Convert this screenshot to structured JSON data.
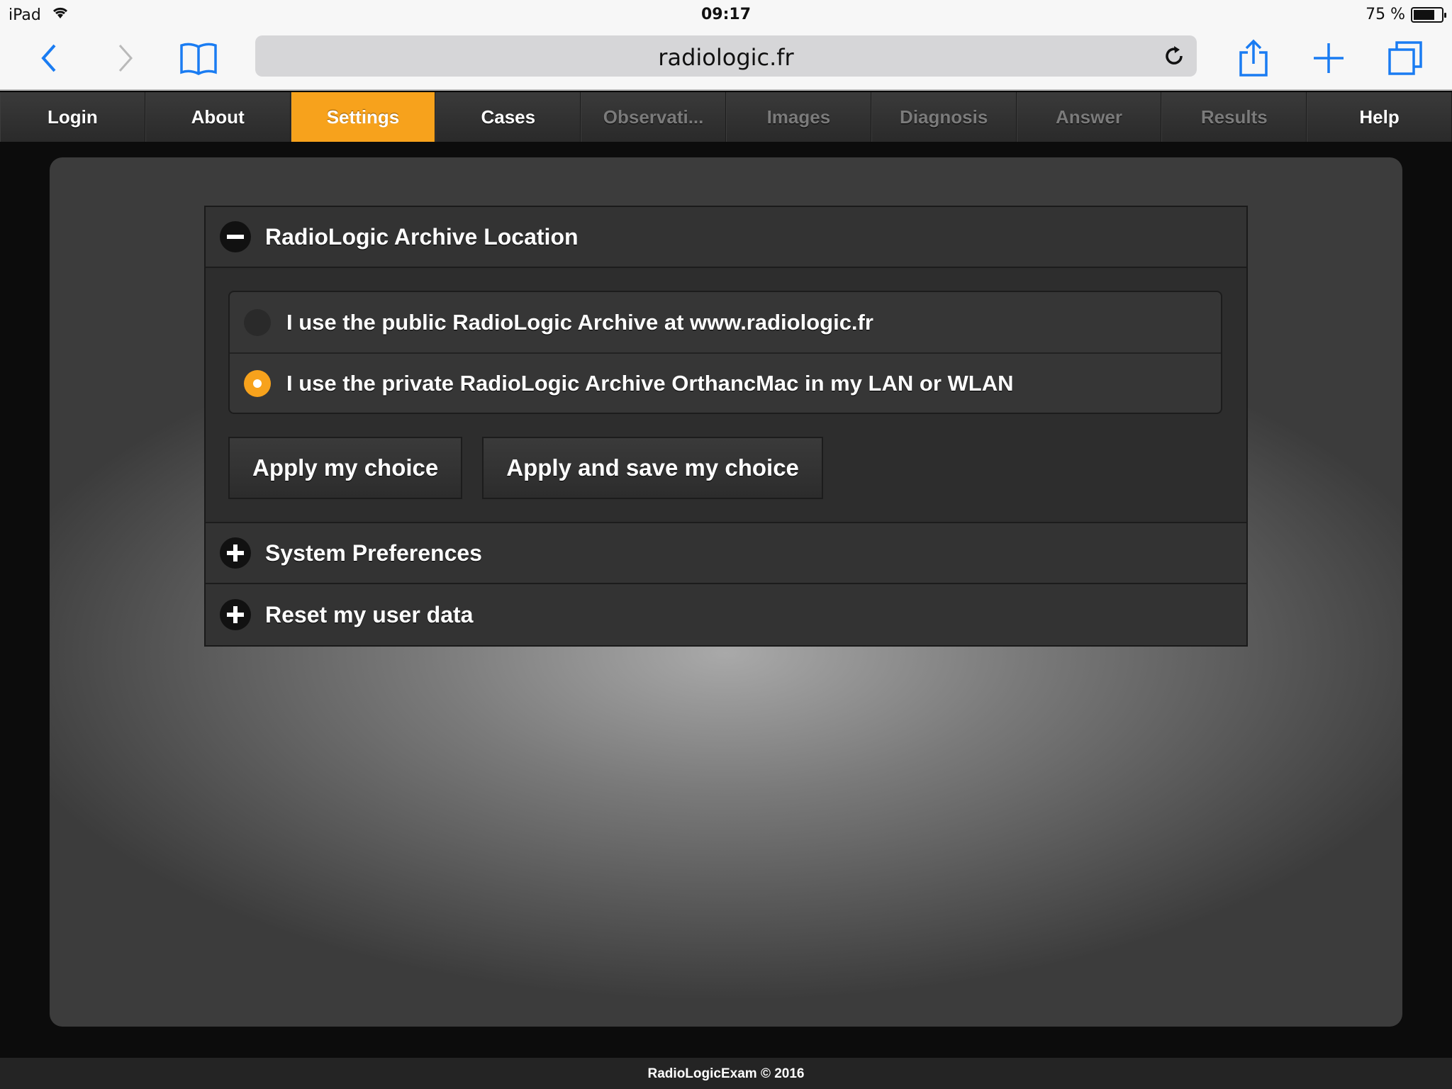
{
  "statusbar": {
    "device": "iPad",
    "time": "09:17",
    "battery_text": "75 %",
    "battery_level": 0.75
  },
  "browser": {
    "url": "radiologic.fr"
  },
  "nav": {
    "items": [
      {
        "label": "Login",
        "state": "normal"
      },
      {
        "label": "About",
        "state": "normal"
      },
      {
        "label": "Settings",
        "state": "active"
      },
      {
        "label": "Cases",
        "state": "normal"
      },
      {
        "label": "Observati...",
        "state": "disabled"
      },
      {
        "label": "Images",
        "state": "disabled"
      },
      {
        "label": "Diagnosis",
        "state": "disabled"
      },
      {
        "label": "Answer",
        "state": "disabled"
      },
      {
        "label": "Results",
        "state": "disabled"
      },
      {
        "label": "Help",
        "state": "normal"
      }
    ]
  },
  "settings": {
    "archive_section": {
      "title": "RadioLogic Archive Location",
      "options": [
        {
          "label": "I use the public RadioLogic Archive at www.radiologic.fr",
          "selected": false
        },
        {
          "label": "I use the private RadioLogic Archive OrthancMac in my LAN or WLAN",
          "selected": true
        }
      ],
      "apply_label": "Apply my choice",
      "apply_save_label": "Apply and save my choice"
    },
    "system_section": {
      "title": "System Preferences"
    },
    "reset_section": {
      "title": "Reset my user data"
    }
  },
  "footer": {
    "text": "RadioLogicExam © 2016"
  },
  "colors": {
    "accent": "#f7a21c",
    "ios_blue": "#1a7cf2"
  }
}
